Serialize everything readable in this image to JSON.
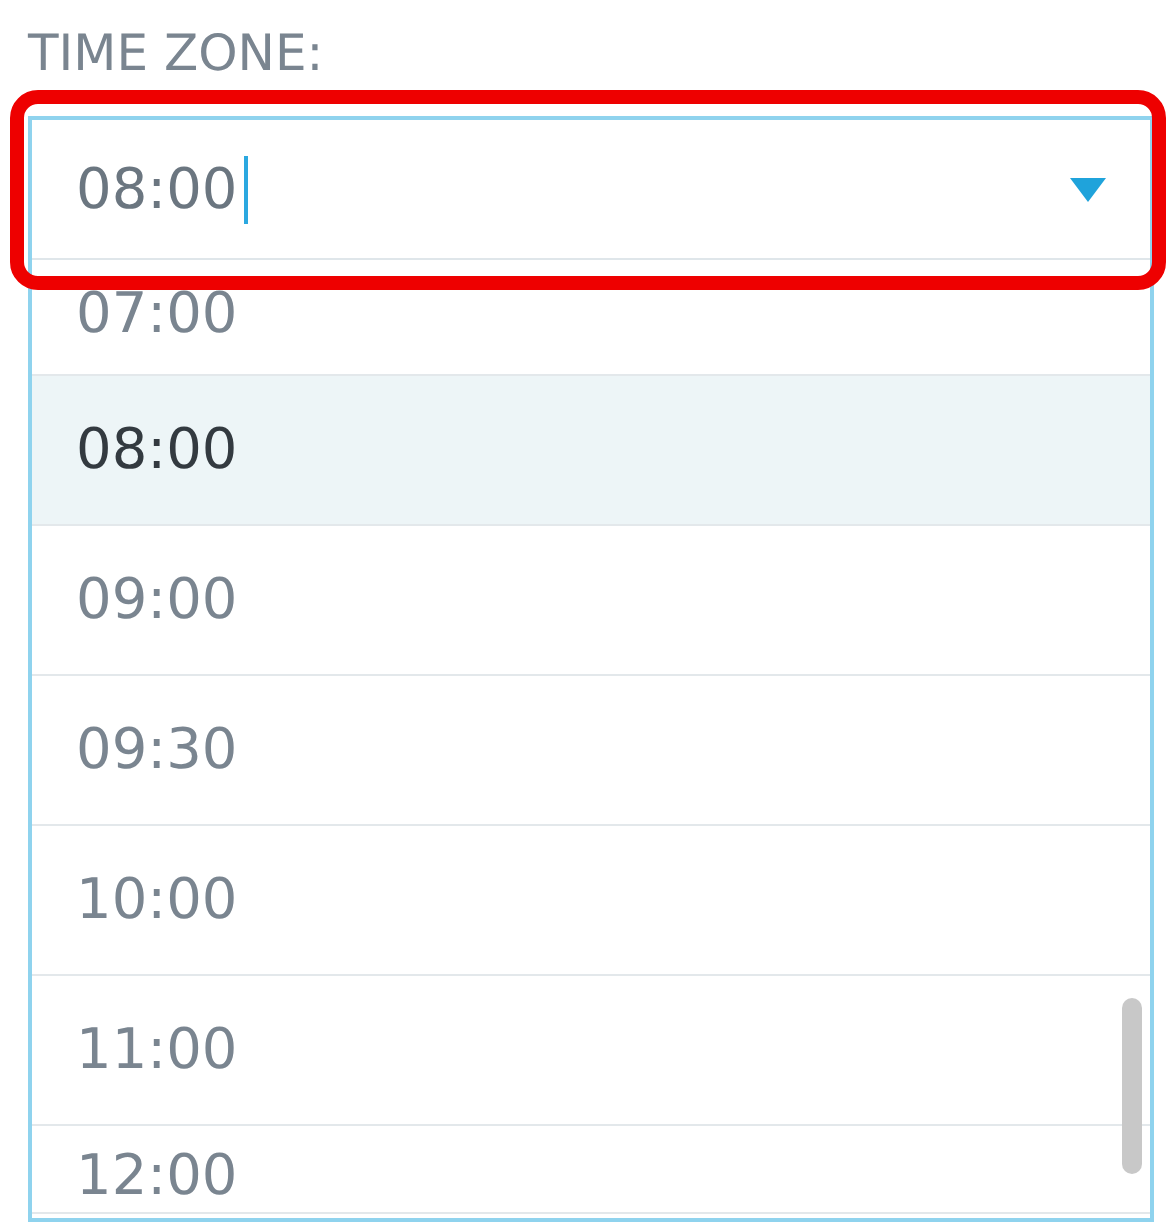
{
  "label": "TIME ZONE:",
  "field": {
    "value": "08:00",
    "highlighted": true,
    "focused": true
  },
  "options": [
    {
      "label": "07:00",
      "selected": false
    },
    {
      "label": "08:00",
      "selected": true
    },
    {
      "label": "09:00",
      "selected": false
    },
    {
      "label": "09:30",
      "selected": false
    },
    {
      "label": "10:00",
      "selected": false
    },
    {
      "label": "11:00",
      "selected": false
    },
    {
      "label": "12:00",
      "selected": false
    }
  ]
}
